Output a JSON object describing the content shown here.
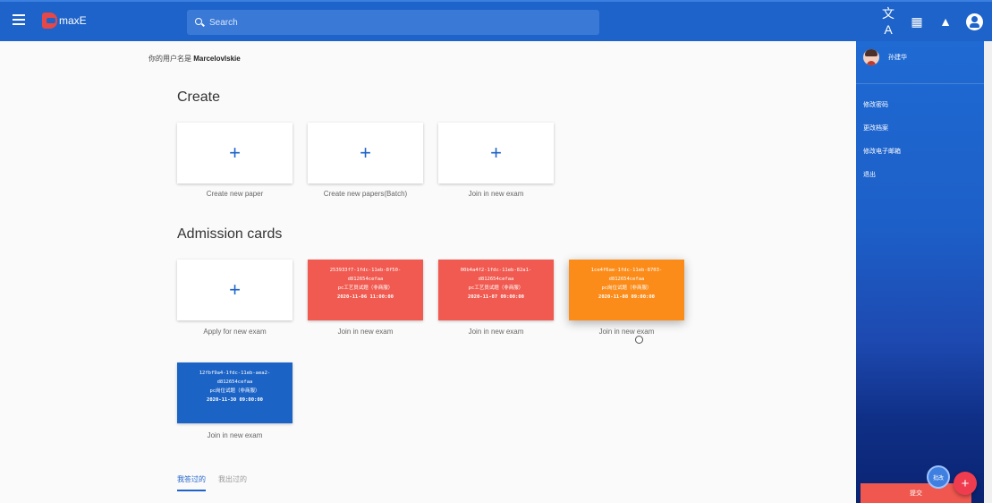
{
  "appbar": {
    "brand": "maxE",
    "search_placeholder": "Search",
    "translate_icon": "文A",
    "apps_icon": "▦",
    "bell_icon": "🔔"
  },
  "main": {
    "username_prefix": "你的用户名是",
    "username": "Marcelovlskie",
    "create_title": "Create",
    "create_cards": [
      {
        "label": "Create new paper"
      },
      {
        "label": "Create new papers(Batch)"
      },
      {
        "label": "Join in new exam"
      }
    ],
    "admission_title": "Admission cards",
    "apply_label": "Apply for new exam",
    "tickets": [
      {
        "id1": "253933f7-1fdc-11eb-8f50-",
        "id2": "d812654cefaa",
        "name": "pc工艺员试题（非商服）",
        "date": "2020-11-06 11:00:00",
        "label": "Join in new exam",
        "color": "red"
      },
      {
        "id1": "00b4a4f2-1fdc-11eb-82a1-",
        "id2": "d812654cefaa",
        "name": "pc工艺员试题（非商服）",
        "date": "2020-11-07 09:00:00",
        "label": "Join in new exam",
        "color": "red"
      },
      {
        "id1": "1ce4f6ae-1fdc-11eb-8703-",
        "id2": "d812654cefaa",
        "name": "pc岗位试题（非商服）",
        "date": "2020-11-08 09:00:00",
        "label": "Join in new exam",
        "color": "orange"
      },
      {
        "id1": "12fbf9a4-1fdc-11eb-aea2-",
        "id2": "d812654cefaa",
        "name": "pc岗位试题（非商服）",
        "date": "2020-11-30 09:00:00",
        "label": "Join in new exam",
        "color": "blue"
      }
    ],
    "tabs": [
      "我答过的",
      "我出过的"
    ]
  },
  "drawer": {
    "user_name": "孙建华",
    "items": [
      "修改密码",
      "更改档案",
      "修改电子邮箱",
      "退出"
    ],
    "bottom_button": "提交",
    "fab_small": "批改",
    "fab": "+"
  },
  "colors": {
    "primary": "#1e63c9",
    "ticket_red": "#f05a50",
    "ticket_orange": "#fb8c1a",
    "ticket_blue": "#1c63c6",
    "fab_red": "#ef3d4f"
  }
}
